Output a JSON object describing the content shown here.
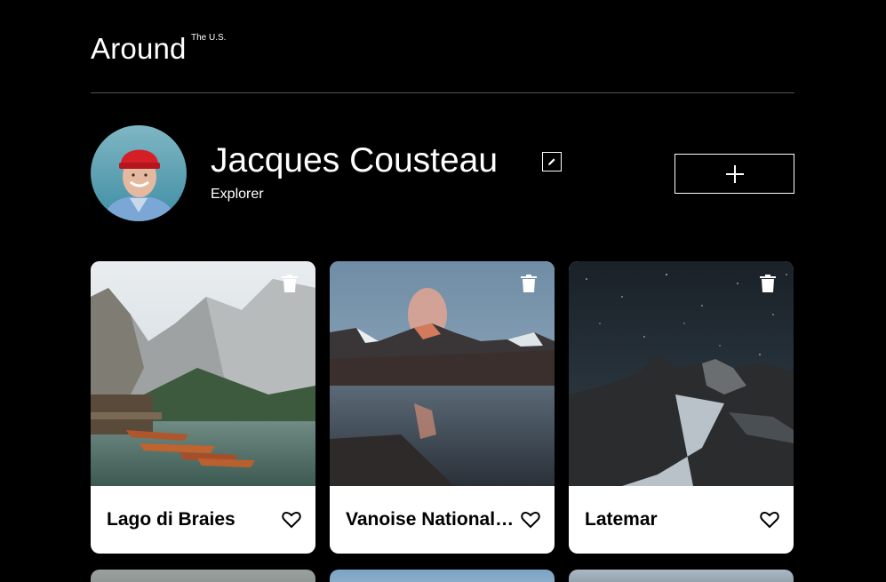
{
  "header": {
    "logo": "Around",
    "logo_superscript": "The U.S."
  },
  "profile": {
    "name": "Jacques Cousteau",
    "job": "Explorer",
    "edit_icon": "pencil-icon",
    "add_icon": "plus-icon"
  },
  "cards": [
    {
      "title": "Lago di Braies"
    },
    {
      "title": "Vanoise National Park"
    },
    {
      "title": "Latemar"
    }
  ],
  "icons": {
    "delete": "trash-icon",
    "like": "heart-outline-icon"
  },
  "colors": {
    "background": "#000000",
    "card": "#ffffff",
    "text_light": "#ffffff",
    "text_dark": "#000000",
    "divider": "#545454"
  }
}
